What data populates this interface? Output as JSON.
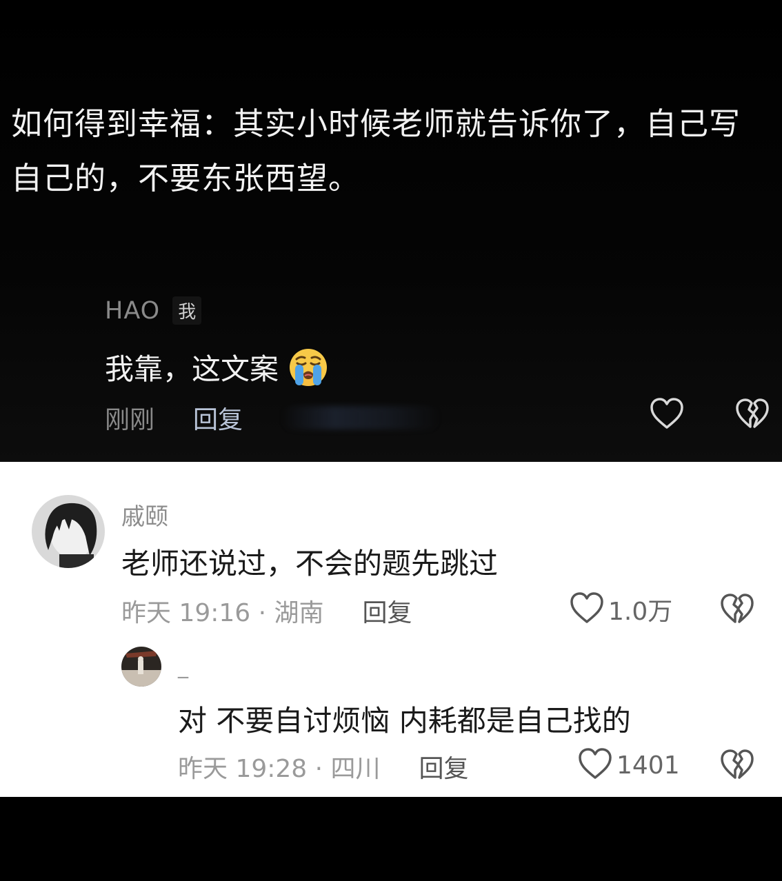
{
  "post": {
    "text": "如何得到幸福：其实小时候老师就告诉你了，自己写自己的，不要东张西望。"
  },
  "dark_comment": {
    "username": "HAO",
    "badge": "我",
    "text": "我靠，这文案",
    "emoji": "crying-face-emoji",
    "time": "刚刚",
    "reply_label": "回复"
  },
  "comments": [
    {
      "username": "戚颐",
      "text": "老师还说过，不会的题先跳过",
      "meta": "昨天 19:16 · 湖南",
      "reply_label": "回复",
      "likes": "1.0万"
    },
    {
      "username": "_",
      "text": "对 不要自讨烦恼 内耗都是自己找的",
      "meta": "昨天 19:28 · 四川",
      "reply_label": "回复",
      "likes": "1401"
    }
  ],
  "icons": {
    "like": "heart-outline-icon",
    "dislike": "broken-heart-icon"
  },
  "colors": {
    "dark_bg": "#000000",
    "light_bg": "#ffffff",
    "dark_reply": "#b9c4d8"
  }
}
